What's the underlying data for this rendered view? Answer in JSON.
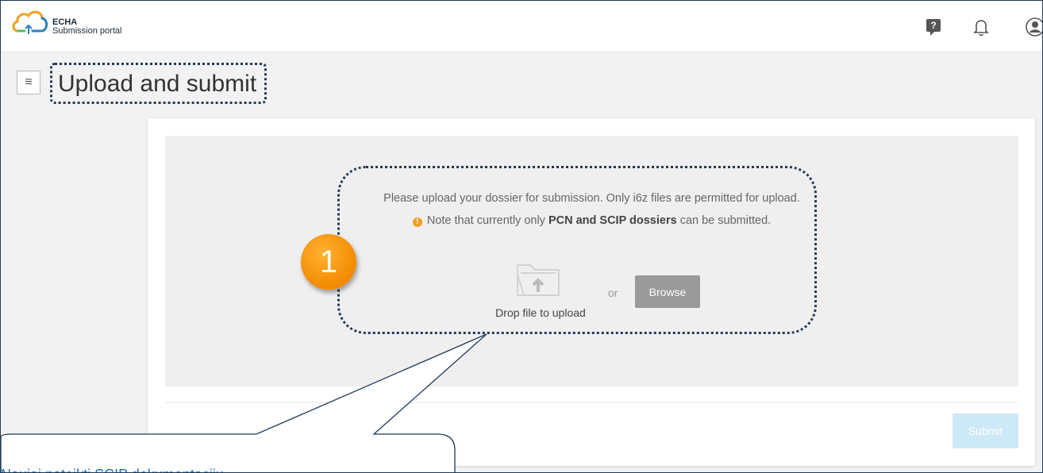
{
  "header": {
    "brand_line1": "ECHA",
    "brand_line2": "Submission portal",
    "icons": [
      "help-icon",
      "bell-icon",
      "user-icon"
    ]
  },
  "page": {
    "title": "Upload and submit"
  },
  "upload": {
    "instructions": "Please upload your dossier for submission. Only i6z files are permitted for upload.",
    "note_prefix": "Note that currently only ",
    "note_bold": "PCN and SCIP dossiers",
    "note_suffix": " can be submitted.",
    "drop_label": "Drop file to upload",
    "or_label": "or",
    "browse_label": "Browse"
  },
  "actions": {
    "submit_label": "Submit"
  },
  "annotation": {
    "step_number": "1",
    "callout_text": "Naujai pateikti SCIP dokumentacijų"
  },
  "colors": {
    "accent_orange": "#f28a00",
    "frame_navy": "#1f3b57",
    "callout_blue": "#1f6fb2",
    "submit_disabled": "#cde8f7",
    "browse_gray": "#9a9a9a"
  }
}
